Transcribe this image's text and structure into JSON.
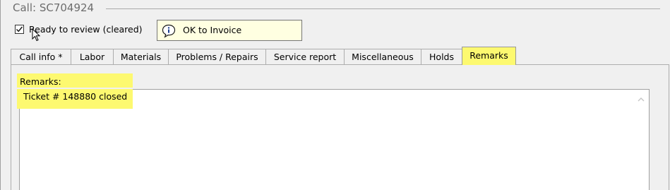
{
  "group": {
    "title": "Call: SC704924"
  },
  "review": {
    "label": "Ready to review (cleared)",
    "checked": true
  },
  "status_badge": {
    "icon": "info-icon",
    "text": "OK to Invoice"
  },
  "tabs": [
    {
      "label": "Call info *",
      "active": false
    },
    {
      "label": "Labor",
      "active": false
    },
    {
      "label": "Materials",
      "active": false
    },
    {
      "label": "Problems / Repairs",
      "active": false
    },
    {
      "label": "Service report",
      "active": false
    },
    {
      "label": "Miscellaneous",
      "active": false
    },
    {
      "label": "Holds",
      "active": false
    },
    {
      "label": "Remarks",
      "active": true
    }
  ],
  "remarks": {
    "label": "Remarks:",
    "lines": [
      "Ticket # 148880 closed"
    ]
  },
  "colors": {
    "highlight": "#fdf970",
    "badge_bg": "#ffffe1"
  }
}
